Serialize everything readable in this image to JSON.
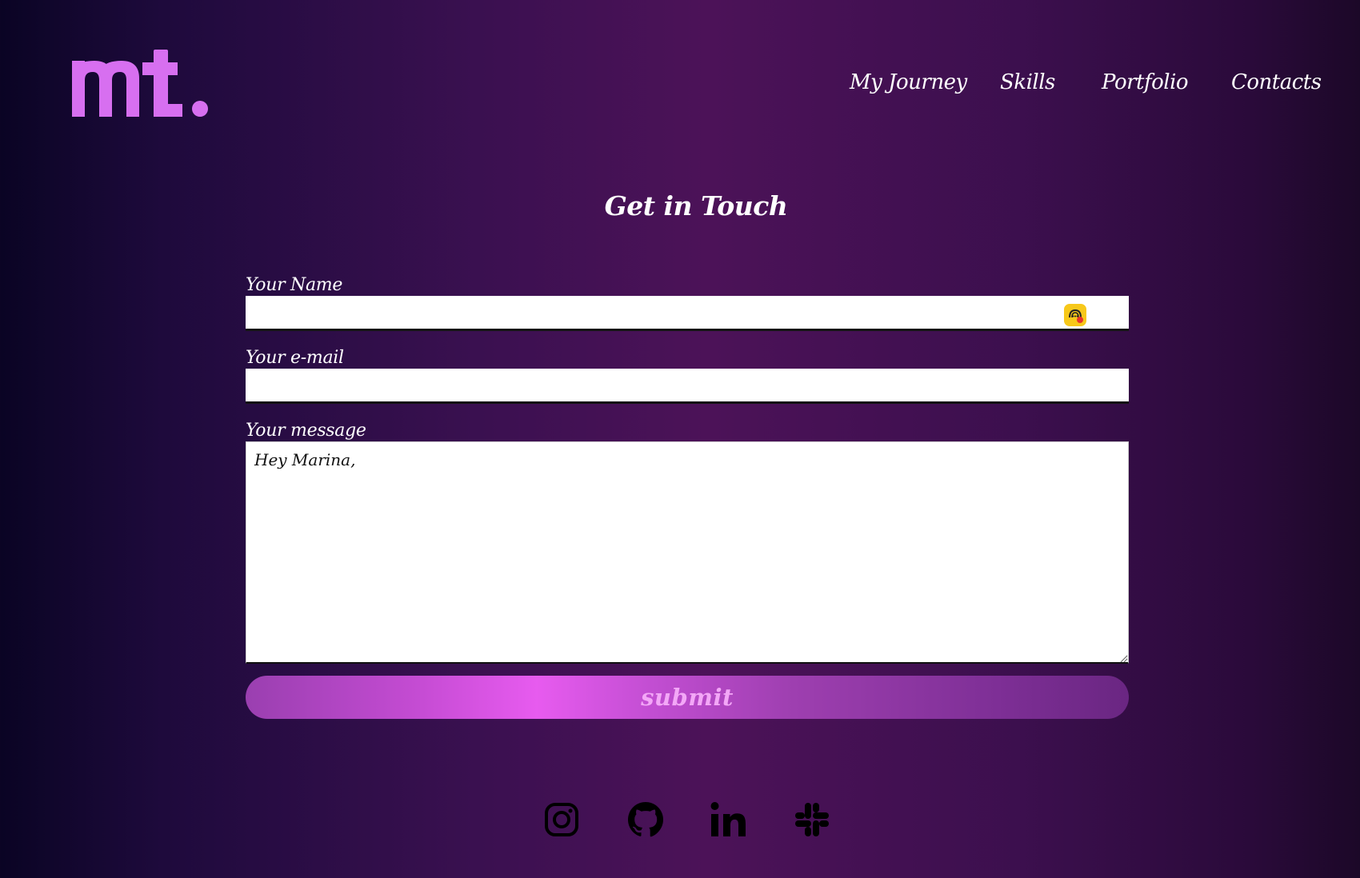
{
  "header": {
    "logo_text": "mt.",
    "nav": [
      {
        "label": "My Journey"
      },
      {
        "label": "Skills"
      },
      {
        "label": "Portfolio"
      },
      {
        "label": "Contacts"
      }
    ]
  },
  "contact": {
    "title": "Get in Touch",
    "name_label": "Your Name",
    "name_value": "",
    "email_label": "Your e-mail",
    "email_value": "",
    "message_label": "Your message",
    "message_value": "Hey Marina,",
    "submit_label": "submit"
  },
  "social": [
    {
      "icon": "instagram-icon"
    },
    {
      "icon": "github-icon"
    },
    {
      "icon": "linkedin-icon"
    },
    {
      "icon": "slack-icon"
    }
  ],
  "colors": {
    "accent": "#d85be6",
    "logo": "#d76ff0",
    "submit_text": "#f3a7f7",
    "extension_icon": "#f7c81a"
  }
}
